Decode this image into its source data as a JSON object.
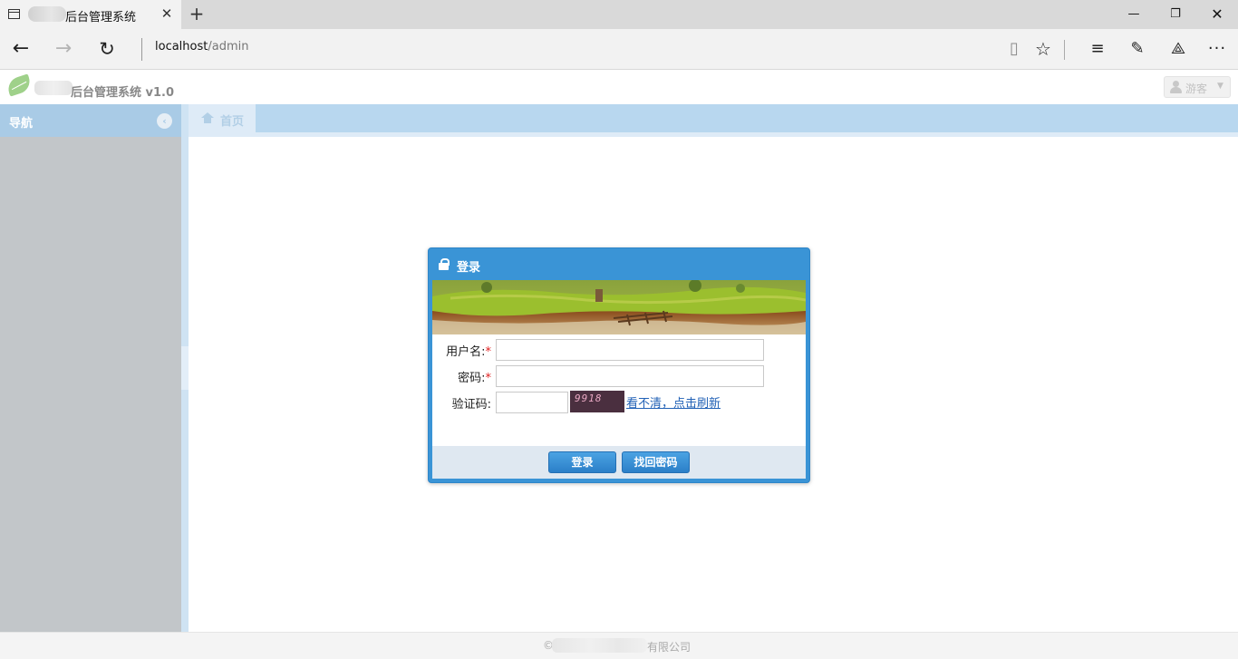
{
  "browser": {
    "tab_title": "后台管理系统",
    "tab_close": "✕",
    "new_tab": "+",
    "url_host": "localhost",
    "url_path": "/admin",
    "window_controls": {
      "minimize": "—",
      "restore": "❐",
      "close": "✕"
    }
  },
  "app": {
    "title": "后台管理系统 v1.0",
    "user_menu": {
      "label": "游客",
      "icon": "user-icon"
    }
  },
  "sidebar": {
    "title": "导航",
    "collapse_icon": "chevron-left-icon"
  },
  "tabs": [
    {
      "label": "首页",
      "icon": "home-icon"
    }
  ],
  "login": {
    "title": "登录",
    "username_label": "用户名:",
    "password_label": "密码:",
    "captcha_label": "验证码:",
    "required_mark": "*",
    "captcha_text": "9918",
    "refresh_link": "看不清，点击刷新",
    "login_button": "登录",
    "forgot_button": "找回密码",
    "username_value": "",
    "password_value": "",
    "captcha_value": ""
  },
  "footer": {
    "copyright": "©",
    "company_suffix": "有限公司"
  },
  "colors": {
    "accent": "#3a94d6",
    "tab_bar": "#b8d7ef",
    "sidebar": "#c2c6c9",
    "link": "#2161b6"
  }
}
